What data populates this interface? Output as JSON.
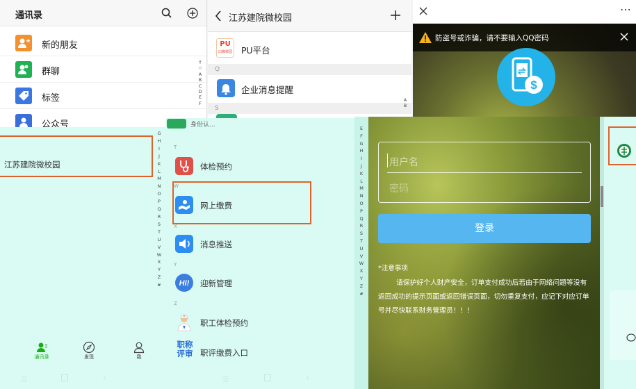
{
  "contacts_panel": {
    "title": "通讯录",
    "items": [
      {
        "label": "新的朋友",
        "color": "#f3912e",
        "icon": "add-friend-icon"
      },
      {
        "label": "群聊",
        "color": "#1fb153",
        "icon": "group-icon"
      },
      {
        "label": "标签",
        "color": "#3a77e0",
        "icon": "tag-icon"
      },
      {
        "label": "公众号",
        "color": "#3a6ed8",
        "icon": "official-account-icon"
      }
    ],
    "index_letters": [
      "↑",
      "☆",
      "A",
      "B",
      "C",
      "D",
      "E",
      "F"
    ]
  },
  "account_panel": {
    "title": "江苏建院微校园",
    "items": [
      {
        "label": "PU平台",
        "icon": "pu-platform-icon"
      },
      {
        "label": "企业消息提醒",
        "icon": "bell-icon"
      }
    ],
    "sections": [
      "Q",
      "S"
    ],
    "index_letters": [
      "A",
      "B"
    ],
    "pu_logo_text": "PU",
    "pu_logo_sub": "口袋校园"
  },
  "payment_header": {
    "warning": "防盗号或诈骗，请不要输入QQ密码"
  },
  "contacts_bottom": {
    "selected_item": "江苏建院微校园",
    "index_letters": [
      "G",
      "H",
      "I",
      "J",
      "K",
      "L",
      "M",
      "N",
      "O",
      "P",
      "Q",
      "R",
      "S",
      "T",
      "U",
      "V",
      "W",
      "X",
      "Y",
      "Z",
      "#"
    ],
    "tabs": [
      {
        "label": "通讯录",
        "icon": "contacts-icon",
        "active": true
      },
      {
        "label": "发现",
        "icon": "compass-icon",
        "active": false
      },
      {
        "label": "我",
        "icon": "me-icon",
        "active": false
      }
    ]
  },
  "service_menu": {
    "partial_top": "身份认...",
    "section_letters": [
      "T",
      "W",
      "X",
      "Y",
      "Z"
    ],
    "items": [
      {
        "label": "体检预约",
        "icon": "stethoscope-icon",
        "color": "#e0504a"
      },
      {
        "label": "网上缴费",
        "icon": "payment-icon",
        "color": "#2e8df0"
      },
      {
        "label": "消息推送",
        "icon": "speaker-icon",
        "color": "#2e8df0"
      },
      {
        "label": "迎新管理",
        "icon": "hi-icon",
        "color": "#3a7ee0"
      },
      {
        "label": "职工体检预约",
        "icon": "doctor-icon",
        "color": "#e86a3a"
      },
      {
        "label": "职评缴费入口",
        "icon": "title-review-icon",
        "color": "#2a6ed8",
        "icon_text": "职称\n评审"
      }
    ],
    "index_letters": [
      "E",
      "F",
      "G",
      "H",
      "I",
      "J",
      "K",
      "L",
      "M",
      "N",
      "O",
      "P",
      "Q",
      "R",
      "S",
      "T",
      "U",
      "V",
      "W",
      "X",
      "Y",
      "Z",
      "#"
    ]
  },
  "login_panel": {
    "username_placeholder": "用户名",
    "password_placeholder": "密码",
    "login_button": "登录",
    "notice_title": "*注意事项",
    "notice_body": "请保护好个人财产安全，订单支付成功后若由于网络问题等没有返回成功的提示页面或返回错误页面，切勿重复支付，应记下对应订单号并尽快联系财务管理员！！！"
  },
  "colors": {
    "highlight": "#e0622a",
    "panel_bg": "#d9fbf3",
    "login_button": "#56b6f0",
    "wechat_green": "#1aad19"
  }
}
